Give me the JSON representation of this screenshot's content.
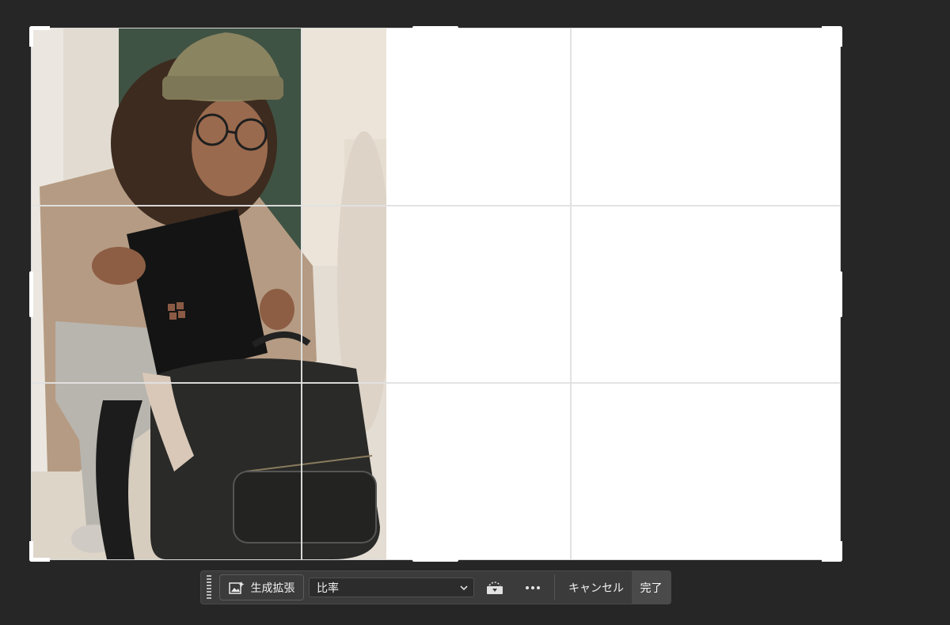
{
  "canvas": {
    "background_color": "#262626",
    "crop_grid": "rule-of-thirds"
  },
  "photo": {
    "description_icon": "photo-person-with-laptop-and-backpack"
  },
  "taskbar": {
    "generative_expand_label": "生成拡張",
    "generative_expand_icon": "generative-expand-icon",
    "ratio_select_value": "比率",
    "ratio_chevron_icon": "chevron-down-icon",
    "straighten_icon": "straighten-icon",
    "more_icon": "more-horizontal-icon",
    "cancel_label": "キャンセル",
    "done_label": "完了"
  },
  "colors": {
    "canvas_bg": "#262626",
    "taskbar_bg": "#3b3b3b",
    "done_bg": "#4a4a4a",
    "crop_fill": "#ffffff"
  }
}
